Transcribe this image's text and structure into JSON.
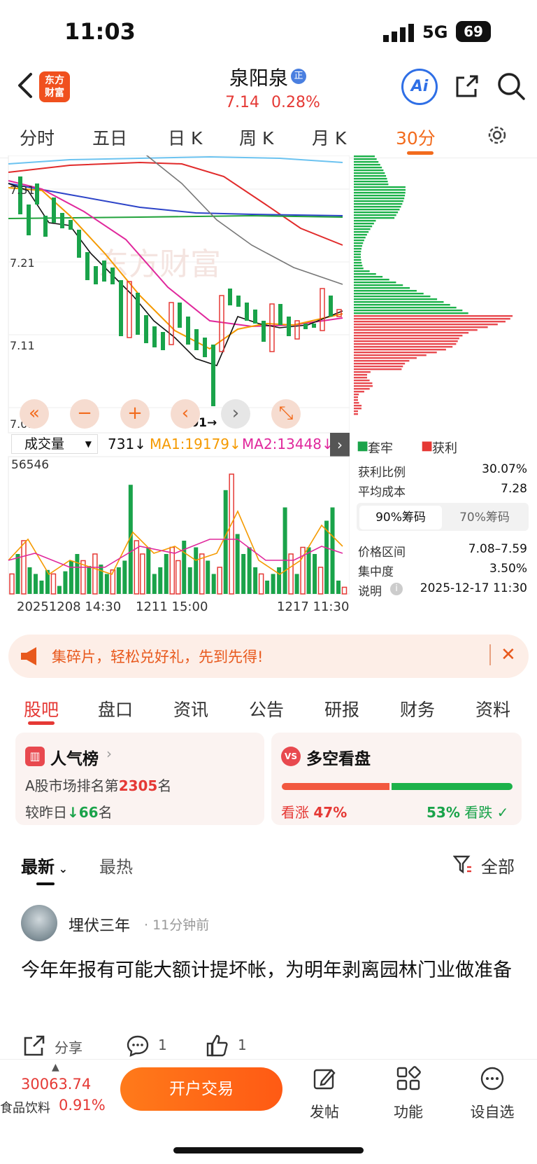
{
  "status": {
    "time": "11:03",
    "network": "5G",
    "battery": "69"
  },
  "header": {
    "logo_line1": "东方",
    "logo_line2": "财富",
    "stock_name": "泉阳泉",
    "badge": "正",
    "price": "7.14",
    "change_pct": "0.28%",
    "ai_label": "Ai"
  },
  "timeframes": [
    "分时",
    "五日",
    "日 K",
    "周 K",
    "月 K",
    "30分"
  ],
  "timeframe_active": "30分",
  "chart": {
    "price_labels": [
      "7.31",
      "7.21",
      "7.11",
      "7.01"
    ],
    "min_marker": "7.01→",
    "watermark": "东方财富",
    "controls": [
      "«",
      "−",
      "+",
      "‹",
      "›",
      "⤡"
    ]
  },
  "chips": {
    "legend_trapped": "套牢",
    "legend_profit": "获利",
    "rows": [
      {
        "label": "获利比例",
        "value": "30.07%"
      },
      {
        "label": "平均成本",
        "value": "7.28"
      }
    ],
    "tabs": [
      "90%筹码",
      "70%筹码"
    ],
    "details": [
      {
        "label": "价格区间",
        "value": "7.08–7.59"
      },
      {
        "label": "集中度",
        "value": "3.50%"
      },
      {
        "label": "说明",
        "value": "2025-12-17 11:30"
      }
    ]
  },
  "volume": {
    "selector": "成交量",
    "current": "731↓",
    "ma1": "MA1:19179↓",
    "ma2": "MA2:13448↓",
    "max_label": "56546",
    "dates": [
      "20251208 14:30",
      "1211 15:00",
      "1217 11:30"
    ]
  },
  "promo": {
    "text": "集碎片，轻松兑好礼，先到先得!"
  },
  "sections": [
    "股吧",
    "盘口",
    "资讯",
    "公告",
    "研报",
    "财务",
    "资料"
  ],
  "popularity": {
    "title": "人气榜",
    "rank_prefix": "A股市场排名第",
    "rank": "2305",
    "rank_suffix": "名",
    "change_prefix": "较昨日",
    "change": "66",
    "change_suffix": "名"
  },
  "sentiment": {
    "title": "多空看盘",
    "bull_label": "看涨",
    "bull_pct": "47%",
    "bear_pct": "53%",
    "bear_label": "看跌",
    "bull_value": 47,
    "bear_value": 53
  },
  "feed": {
    "tabs": [
      "最新",
      "最热"
    ],
    "filter": "全部",
    "post": {
      "author": "埋伏三年",
      "time": "· 11分钟前",
      "text": "今年年报有可能大额计提坏帐，为明年剥离园林门业做准备",
      "share": "分享",
      "comments": "1",
      "likes": "1"
    }
  },
  "bottom": {
    "index_value": "30063.74",
    "index_name": "食品饮料",
    "index_change": "0.91%",
    "trade_button": "开户交易",
    "nav": [
      "发帖",
      "功能",
      "设自选"
    ]
  },
  "colors": {
    "up": "#e53935",
    "down": "#1aa34a",
    "accent": "#f26b1d"
  }
}
